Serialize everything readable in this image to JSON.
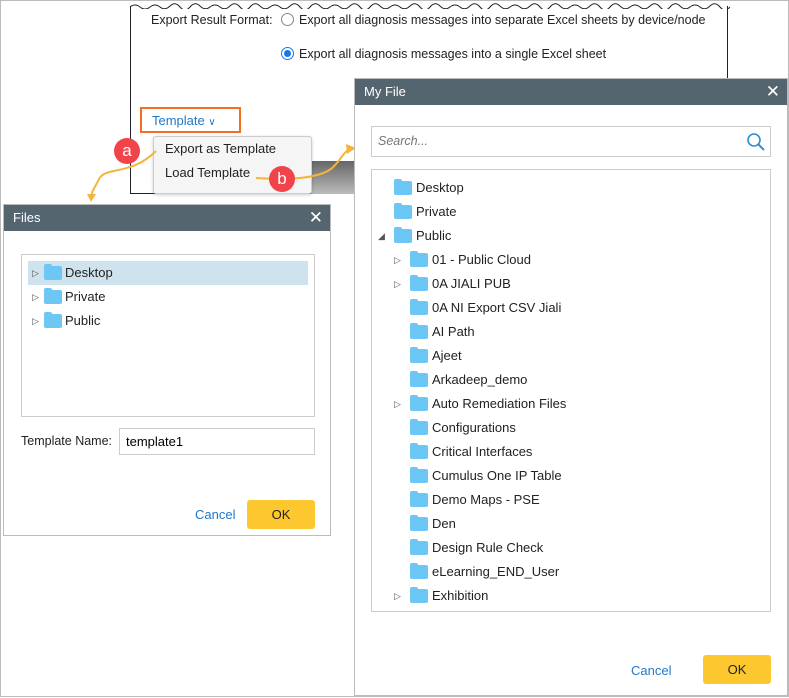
{
  "export": {
    "label": "Export Result Format:",
    "opt1": "Export all diagnosis messages into separate Excel sheets by device/node",
    "opt2": "Export all diagnosis messages into a single Excel sheet",
    "selected": 2
  },
  "template_button": "Template",
  "template_menu": [
    "Export as Template",
    "Load Template"
  ],
  "badges": {
    "a": "a",
    "b": "b"
  },
  "files_dialog": {
    "title": "Files",
    "tree": [
      "Desktop",
      "Private",
      "Public"
    ],
    "template_name_label": "Template Name:",
    "template_name_value": "template1",
    "cancel": "Cancel",
    "ok": "OK"
  },
  "my_file_dialog": {
    "title": "My File",
    "search_placeholder": "Search...",
    "cancel": "Cancel",
    "ok": "OK",
    "tree": [
      {
        "label": "Desktop",
        "level": 0,
        "toggle": ""
      },
      {
        "label": "Private",
        "level": 0,
        "toggle": ""
      },
      {
        "label": "Public",
        "level": 0,
        "toggle": "expanded"
      },
      {
        "label": "01 - Public Cloud",
        "level": 1,
        "toggle": "collapsed"
      },
      {
        "label": "0A JIALI PUB",
        "level": 1,
        "toggle": "collapsed"
      },
      {
        "label": "0A NI Export CSV Jiali",
        "level": 1,
        "toggle": ""
      },
      {
        "label": "AI Path",
        "level": 1,
        "toggle": ""
      },
      {
        "label": "Ajeet",
        "level": 1,
        "toggle": ""
      },
      {
        "label": "Arkadeep_demo",
        "level": 1,
        "toggle": ""
      },
      {
        "label": "Auto Remediation Files",
        "level": 1,
        "toggle": "collapsed"
      },
      {
        "label": "Configurations",
        "level": 1,
        "toggle": ""
      },
      {
        "label": "Critical Interfaces",
        "level": 1,
        "toggle": ""
      },
      {
        "label": "Cumulus One IP Table",
        "level": 1,
        "toggle": ""
      },
      {
        "label": "Demo Maps - PSE",
        "level": 1,
        "toggle": ""
      },
      {
        "label": "Den",
        "level": 1,
        "toggle": ""
      },
      {
        "label": "Design Rule Check",
        "level": 1,
        "toggle": ""
      },
      {
        "label": "eLearning_END_User",
        "level": 1,
        "toggle": ""
      },
      {
        "label": "Exhibition",
        "level": 1,
        "toggle": "collapsed"
      }
    ]
  }
}
